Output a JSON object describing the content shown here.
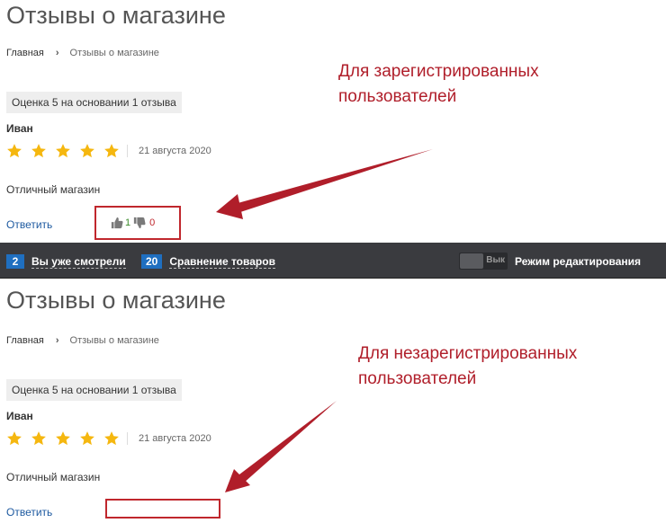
{
  "registered": {
    "page_title": "Отзывы о магазине",
    "breadcrumb": {
      "home": "Главная",
      "separator": "›",
      "current": "Отзывы о магазине"
    },
    "rating_summary": "Оценка 5 на основании 1 отзыва",
    "review": {
      "author": "Иван",
      "rating": 5,
      "date": "21 августа 2020",
      "text": "Отличный магазин",
      "reply": "Ответить",
      "likes": "1",
      "dislikes": "0"
    },
    "annotation_line1": "Для зарегистрированных",
    "annotation_line2": "пользователей"
  },
  "toolbar": {
    "viewed_count": "2",
    "viewed_label": "Вы уже смотрели",
    "compare_count": "20",
    "compare_label": "Сравнение товаров",
    "toggle_state": "Вык",
    "edit_mode_label": "Режим редактирования"
  },
  "unregistered": {
    "page_title": "Отзывы о магазине",
    "breadcrumb": {
      "home": "Главная",
      "separator": "›",
      "current": "Отзывы о магазине"
    },
    "rating_summary": "Оценка 5 на основании 1 отзыва",
    "review": {
      "author": "Иван",
      "rating": 5,
      "date": "21 августа 2020",
      "text": "Отличный магазин",
      "reply": "Ответить"
    },
    "annotation_line1": "Для незарегистрированных",
    "annotation_line2": "пользователей"
  },
  "colors": {
    "star": "#f5b70f",
    "annotation": "#b01e2a",
    "link": "#1e5aa0",
    "badge": "#1f6fc0",
    "toolbar_bg": "#3a3b3f"
  },
  "icons": {
    "star": "star-icon",
    "like": "thumbs-up-icon",
    "dislike": "thumbs-down-icon",
    "breadcrumb_sep": "chevron-right-icon"
  }
}
